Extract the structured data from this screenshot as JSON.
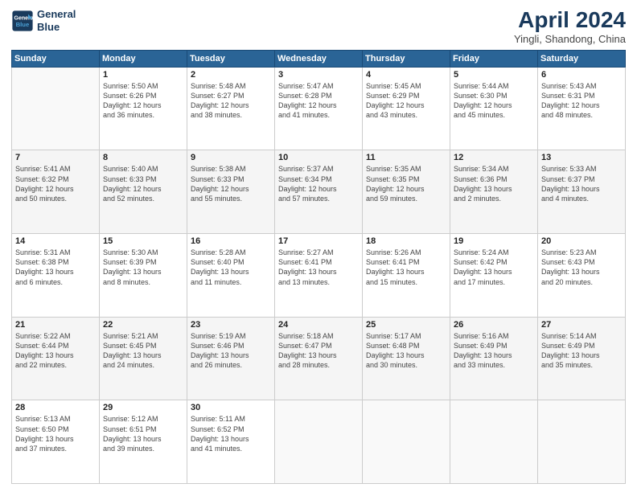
{
  "header": {
    "logo_line1": "General",
    "logo_line2": "Blue",
    "title": "April 2024",
    "location": "Yingli, Shandong, China"
  },
  "weekdays": [
    "Sunday",
    "Monday",
    "Tuesday",
    "Wednesday",
    "Thursday",
    "Friday",
    "Saturday"
  ],
  "weeks": [
    [
      {
        "day": "",
        "detail": ""
      },
      {
        "day": "1",
        "detail": "Sunrise: 5:50 AM\nSunset: 6:26 PM\nDaylight: 12 hours\nand 36 minutes."
      },
      {
        "day": "2",
        "detail": "Sunrise: 5:48 AM\nSunset: 6:27 PM\nDaylight: 12 hours\nand 38 minutes."
      },
      {
        "day": "3",
        "detail": "Sunrise: 5:47 AM\nSunset: 6:28 PM\nDaylight: 12 hours\nand 41 minutes."
      },
      {
        "day": "4",
        "detail": "Sunrise: 5:45 AM\nSunset: 6:29 PM\nDaylight: 12 hours\nand 43 minutes."
      },
      {
        "day": "5",
        "detail": "Sunrise: 5:44 AM\nSunset: 6:30 PM\nDaylight: 12 hours\nand 45 minutes."
      },
      {
        "day": "6",
        "detail": "Sunrise: 5:43 AM\nSunset: 6:31 PM\nDaylight: 12 hours\nand 48 minutes."
      }
    ],
    [
      {
        "day": "7",
        "detail": "Sunrise: 5:41 AM\nSunset: 6:32 PM\nDaylight: 12 hours\nand 50 minutes."
      },
      {
        "day": "8",
        "detail": "Sunrise: 5:40 AM\nSunset: 6:33 PM\nDaylight: 12 hours\nand 52 minutes."
      },
      {
        "day": "9",
        "detail": "Sunrise: 5:38 AM\nSunset: 6:33 PM\nDaylight: 12 hours\nand 55 minutes."
      },
      {
        "day": "10",
        "detail": "Sunrise: 5:37 AM\nSunset: 6:34 PM\nDaylight: 12 hours\nand 57 minutes."
      },
      {
        "day": "11",
        "detail": "Sunrise: 5:35 AM\nSunset: 6:35 PM\nDaylight: 12 hours\nand 59 minutes."
      },
      {
        "day": "12",
        "detail": "Sunrise: 5:34 AM\nSunset: 6:36 PM\nDaylight: 13 hours\nand 2 minutes."
      },
      {
        "day": "13",
        "detail": "Sunrise: 5:33 AM\nSunset: 6:37 PM\nDaylight: 13 hours\nand 4 minutes."
      }
    ],
    [
      {
        "day": "14",
        "detail": "Sunrise: 5:31 AM\nSunset: 6:38 PM\nDaylight: 13 hours\nand 6 minutes."
      },
      {
        "day": "15",
        "detail": "Sunrise: 5:30 AM\nSunset: 6:39 PM\nDaylight: 13 hours\nand 8 minutes."
      },
      {
        "day": "16",
        "detail": "Sunrise: 5:28 AM\nSunset: 6:40 PM\nDaylight: 13 hours\nand 11 minutes."
      },
      {
        "day": "17",
        "detail": "Sunrise: 5:27 AM\nSunset: 6:41 PM\nDaylight: 13 hours\nand 13 minutes."
      },
      {
        "day": "18",
        "detail": "Sunrise: 5:26 AM\nSunset: 6:41 PM\nDaylight: 13 hours\nand 15 minutes."
      },
      {
        "day": "19",
        "detail": "Sunrise: 5:24 AM\nSunset: 6:42 PM\nDaylight: 13 hours\nand 17 minutes."
      },
      {
        "day": "20",
        "detail": "Sunrise: 5:23 AM\nSunset: 6:43 PM\nDaylight: 13 hours\nand 20 minutes."
      }
    ],
    [
      {
        "day": "21",
        "detail": "Sunrise: 5:22 AM\nSunset: 6:44 PM\nDaylight: 13 hours\nand 22 minutes."
      },
      {
        "day": "22",
        "detail": "Sunrise: 5:21 AM\nSunset: 6:45 PM\nDaylight: 13 hours\nand 24 minutes."
      },
      {
        "day": "23",
        "detail": "Sunrise: 5:19 AM\nSunset: 6:46 PM\nDaylight: 13 hours\nand 26 minutes."
      },
      {
        "day": "24",
        "detail": "Sunrise: 5:18 AM\nSunset: 6:47 PM\nDaylight: 13 hours\nand 28 minutes."
      },
      {
        "day": "25",
        "detail": "Sunrise: 5:17 AM\nSunset: 6:48 PM\nDaylight: 13 hours\nand 30 minutes."
      },
      {
        "day": "26",
        "detail": "Sunrise: 5:16 AM\nSunset: 6:49 PM\nDaylight: 13 hours\nand 33 minutes."
      },
      {
        "day": "27",
        "detail": "Sunrise: 5:14 AM\nSunset: 6:49 PM\nDaylight: 13 hours\nand 35 minutes."
      }
    ],
    [
      {
        "day": "28",
        "detail": "Sunrise: 5:13 AM\nSunset: 6:50 PM\nDaylight: 13 hours\nand 37 minutes."
      },
      {
        "day": "29",
        "detail": "Sunrise: 5:12 AM\nSunset: 6:51 PM\nDaylight: 13 hours\nand 39 minutes."
      },
      {
        "day": "30",
        "detail": "Sunrise: 5:11 AM\nSunset: 6:52 PM\nDaylight: 13 hours\nand 41 minutes."
      },
      {
        "day": "",
        "detail": ""
      },
      {
        "day": "",
        "detail": ""
      },
      {
        "day": "",
        "detail": ""
      },
      {
        "day": "",
        "detail": ""
      }
    ]
  ]
}
